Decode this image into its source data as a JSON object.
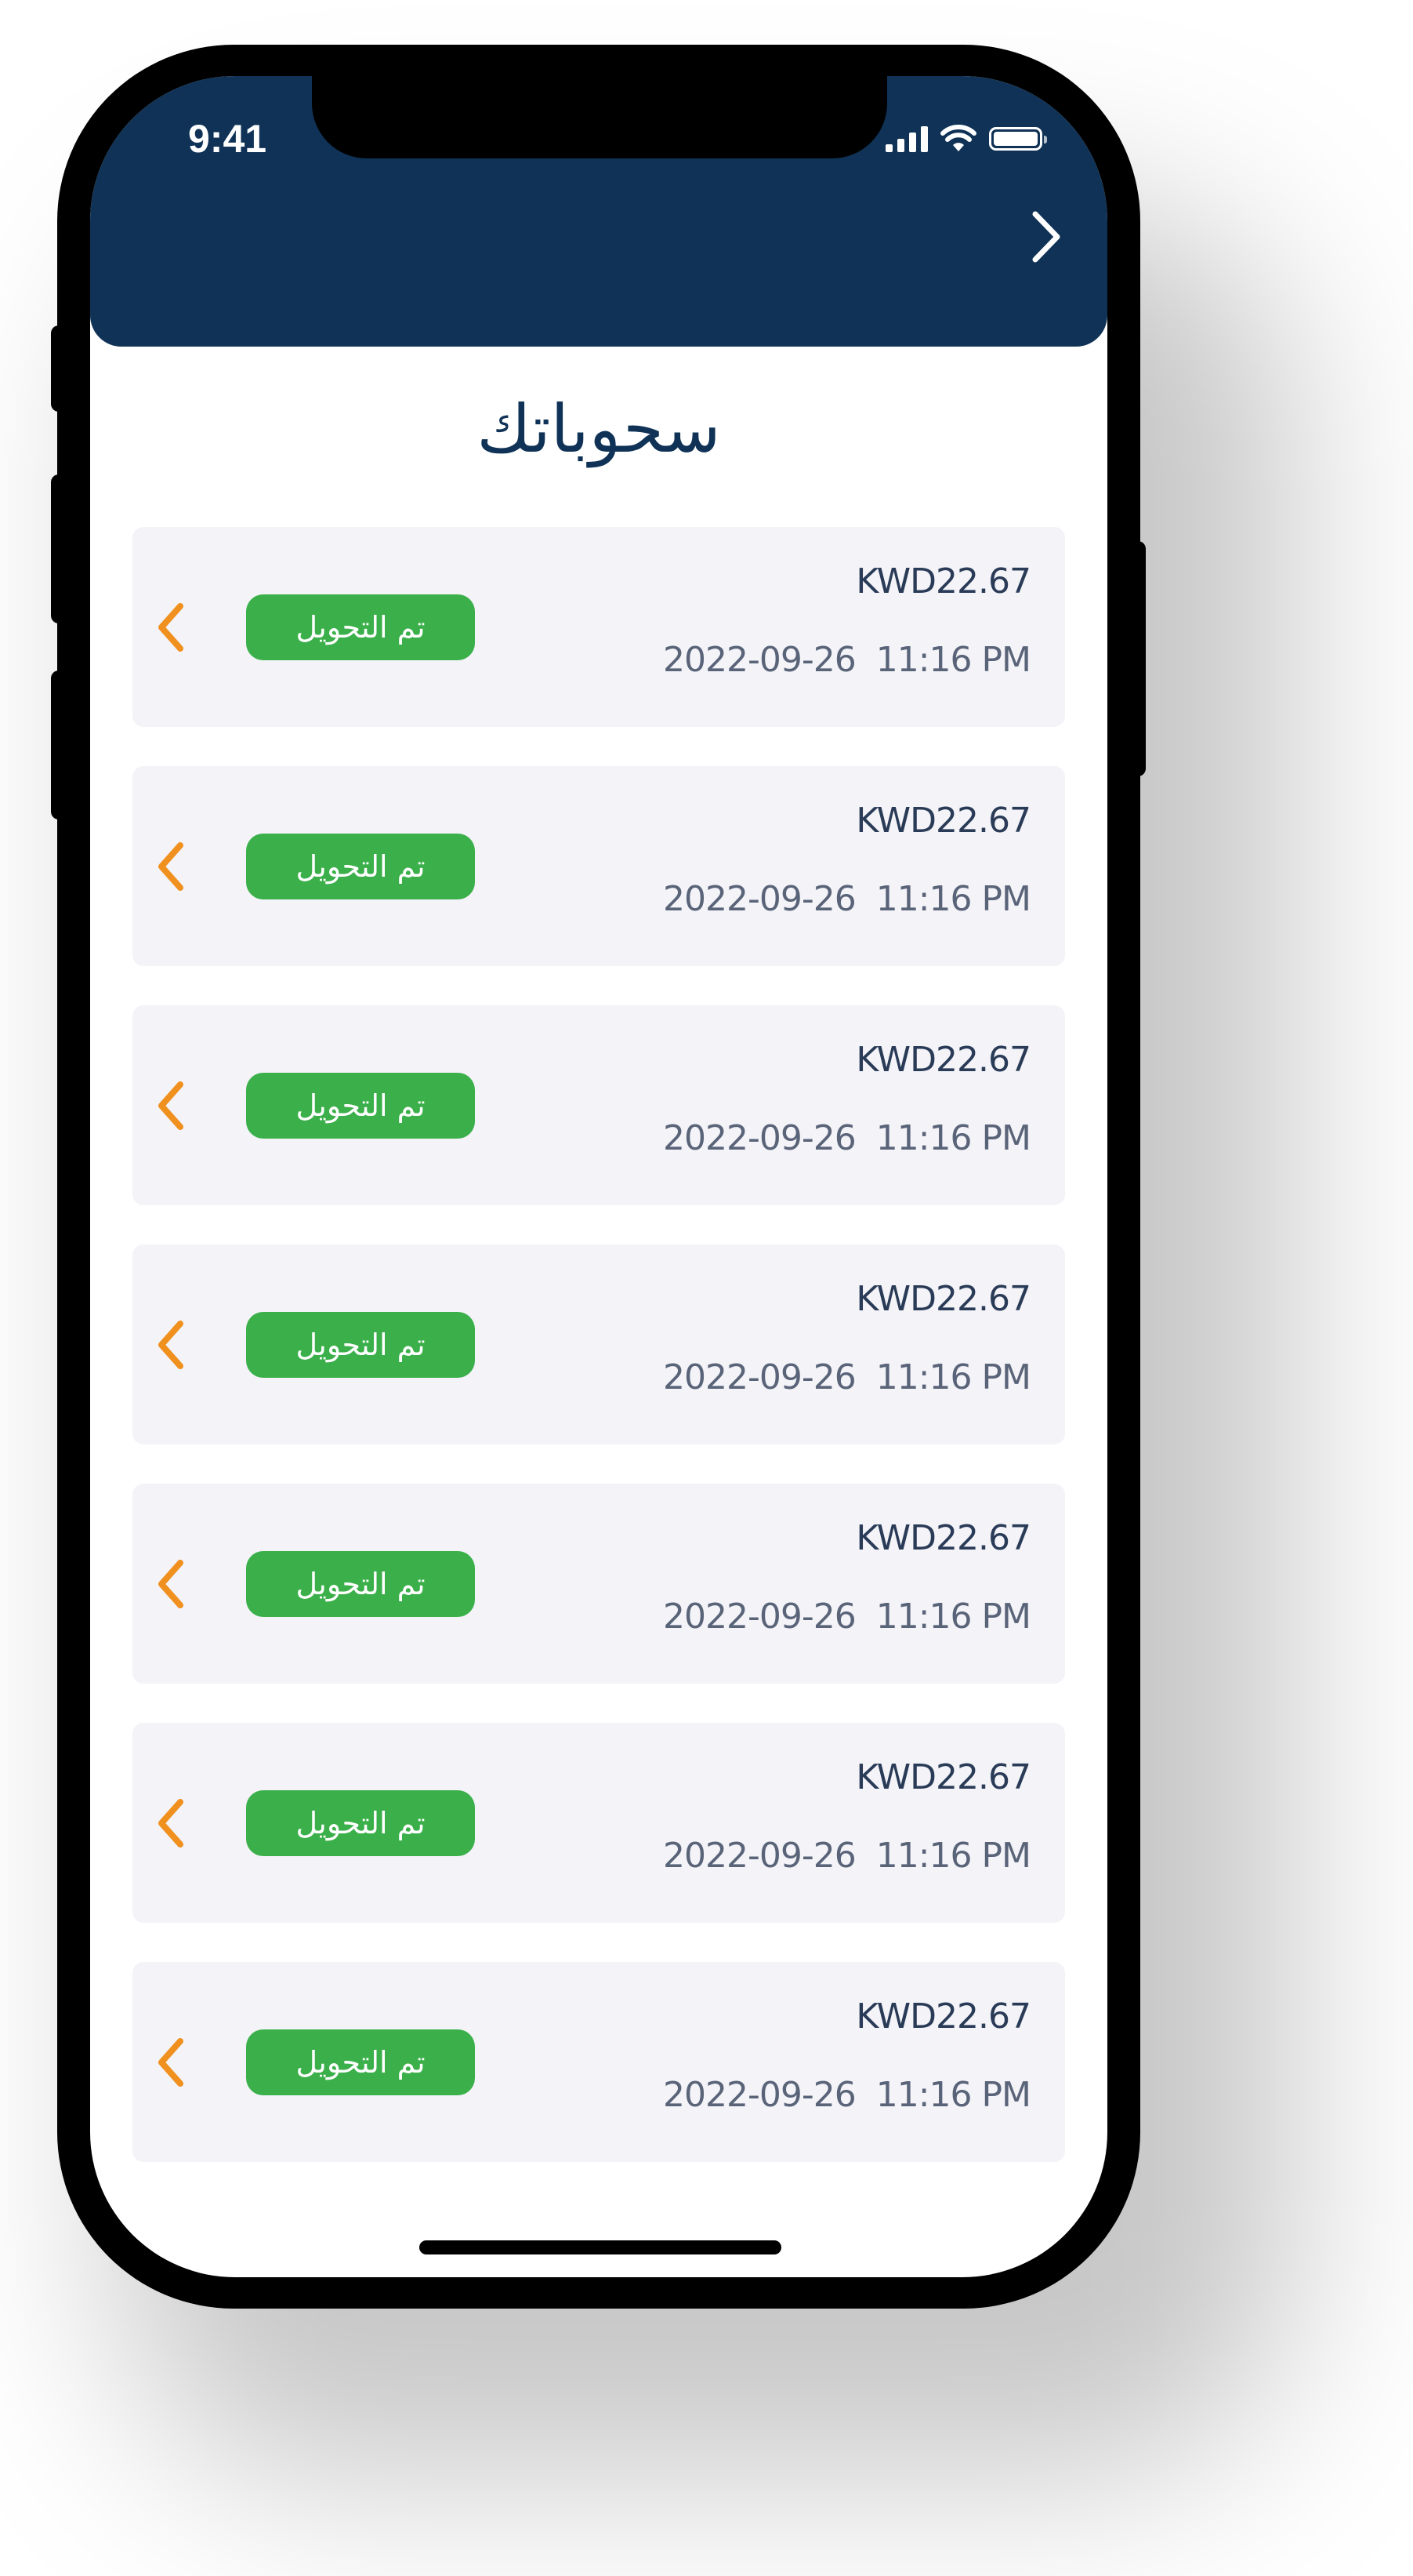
{
  "status_bar": {
    "time": "9:41"
  },
  "header": {
    "back_icon": "chevron-right-icon",
    "background_color": "#0f3256"
  },
  "page": {
    "title": "سحوباتك"
  },
  "colors": {
    "badge_green": "#3bb04a",
    "chevron_orange": "#f0901e",
    "card_background": "#f3f3f8",
    "title_navy": "#0f3256"
  },
  "withdrawals": [
    {
      "amount": "KWD22.67",
      "datetime": "2022-09-26  11:16 PM",
      "status": "تم التحويل",
      "icon": "chevron-left-icon"
    },
    {
      "amount": "KWD22.67",
      "datetime": "2022-09-26  11:16 PM",
      "status": "تم التحويل",
      "icon": "chevron-left-icon"
    },
    {
      "amount": "KWD22.67",
      "datetime": "2022-09-26  11:16 PM",
      "status": "تم التحويل",
      "icon": "chevron-left-icon"
    },
    {
      "amount": "KWD22.67",
      "datetime": "2022-09-26  11:16 PM",
      "status": "تم التحويل",
      "icon": "chevron-left-icon"
    },
    {
      "amount": "KWD22.67",
      "datetime": "2022-09-26  11:16 PM",
      "status": "تم التحويل",
      "icon": "chevron-left-icon"
    },
    {
      "amount": "KWD22.67",
      "datetime": "2022-09-26  11:16 PM",
      "status": "تم التحويل",
      "icon": "chevron-left-icon"
    },
    {
      "amount": "KWD22.67",
      "datetime": "2022-09-26  11:16 PM",
      "status": "تم التحويل",
      "icon": "chevron-left-icon"
    }
  ]
}
